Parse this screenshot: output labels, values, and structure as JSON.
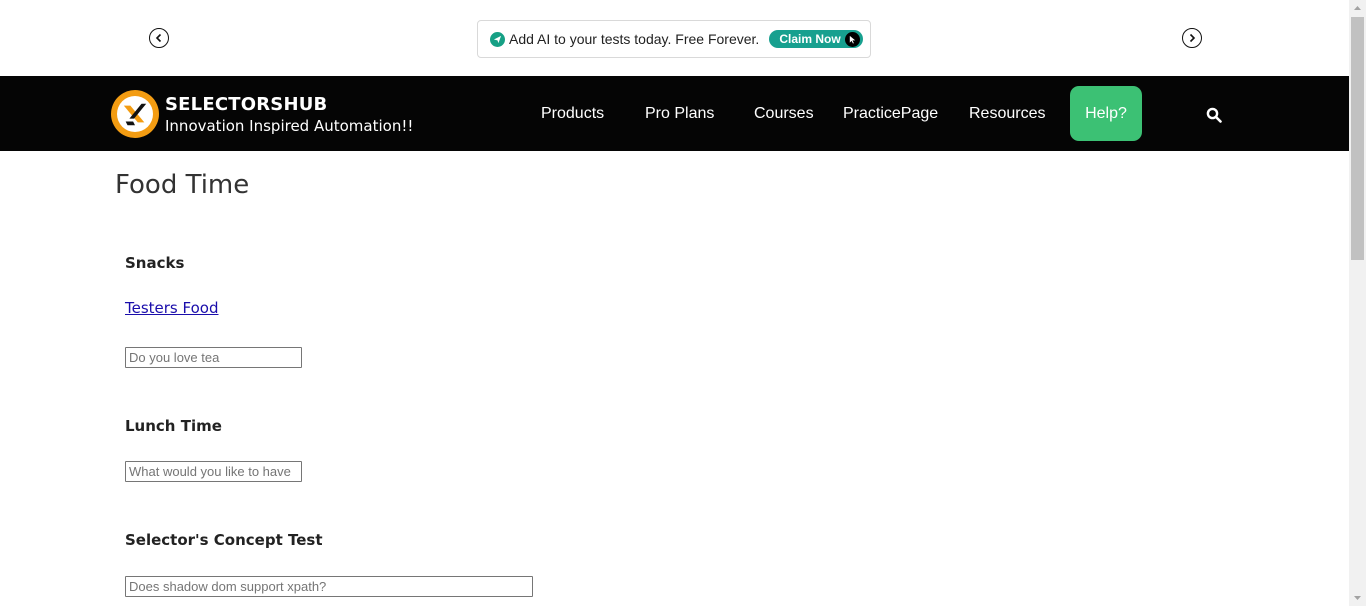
{
  "promo": {
    "text": "Add AI to your tests today. Free Forever.",
    "cta_label": "Claim Now",
    "accent_color": "#17a08f"
  },
  "header": {
    "brand_name": "SELECTORSHUB",
    "brand_tagline": "Innovation Inspired Automation!!",
    "menu": [
      {
        "label": "Products"
      },
      {
        "label": "Pro Plans"
      },
      {
        "label": "Courses"
      },
      {
        "label": "PracticePage"
      },
      {
        "label": "Resources"
      }
    ],
    "help_label": "Help?",
    "help_color": "#3cc174",
    "icons": [
      "chevron-left-icon",
      "chevron-right-icon",
      "search-icon",
      "logo-icon"
    ]
  },
  "main": {
    "title": "Food Time",
    "snacks": {
      "label": "Snacks",
      "link_text": "Testers Food",
      "input_placeholder": "Do you love tea"
    },
    "lunch": {
      "label": "Lunch Time",
      "input_placeholder": "What would you like to have"
    },
    "concept": {
      "label": "Selector's Concept Test",
      "input_placeholder": "Does shadow dom support xpath?"
    }
  }
}
